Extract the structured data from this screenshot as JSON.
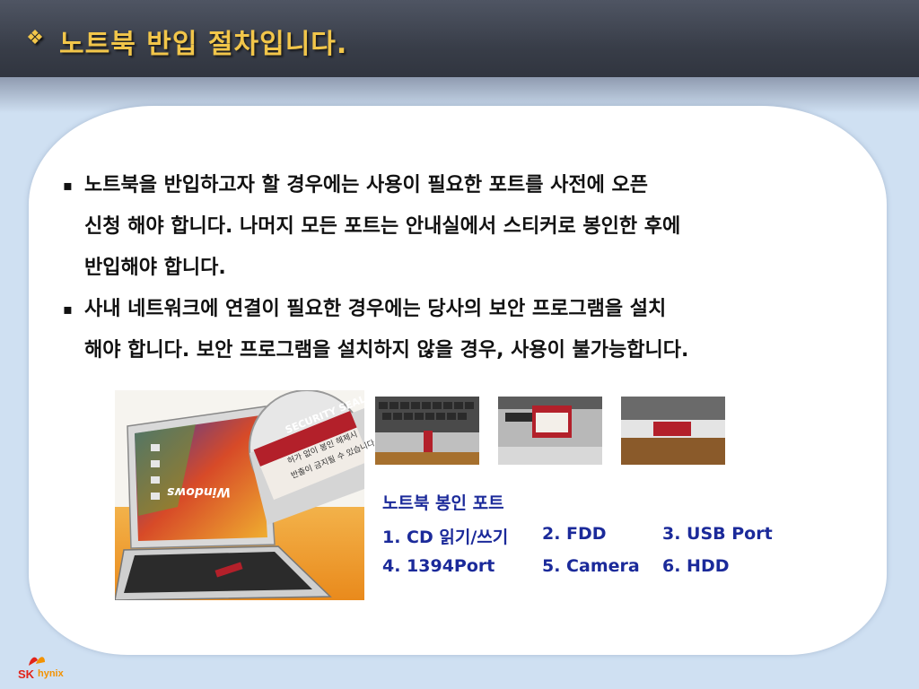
{
  "header": {
    "title": "노트북 반입 절차입니다.",
    "bullet_symbol": "❖"
  },
  "body": {
    "bullets": [
      {
        "marker": "▪",
        "lines": [
          "노트북을 반입하고자 할 경우에는 사용이 필요한 포트를 사전에 오픈",
          "신청 해야 합니다. 나머지 모든 포트는 안내실에서 스티커로 봉인한 후에",
          "반입해야 합니다."
        ]
      },
      {
        "marker": "▪",
        "lines": [
          "사내 네트워크에 연결이 필요한 경우에는 당사의 보안 프로그램을 설치",
          "해야 합니다. 보안 프로그램을 설치하지 않을 경우, 사용이 불가능합니다."
        ]
      }
    ]
  },
  "illustration": {
    "seal_title": "SECURITY SEAL",
    "seal_line1": "허가 없이 봉인 해제시",
    "seal_line2": "반출이 금지될 수 있습니다.",
    "screen_text": "Windows"
  },
  "ports": {
    "title": "노트북 봉인 포트",
    "items": [
      "1. CD 읽기/쓰기",
      "2. FDD",
      "3. USB Port",
      "4. 1394Port",
      "5. Camera",
      "6. HDD"
    ]
  },
  "logo": {
    "brand": "SK",
    "name": "hynix"
  },
  "colors": {
    "title": "#f2c64a",
    "ports_text": "#1b2a9a",
    "seal_red": "#b3202a",
    "logo_red": "#e2231a",
    "logo_orange": "#f39200"
  }
}
